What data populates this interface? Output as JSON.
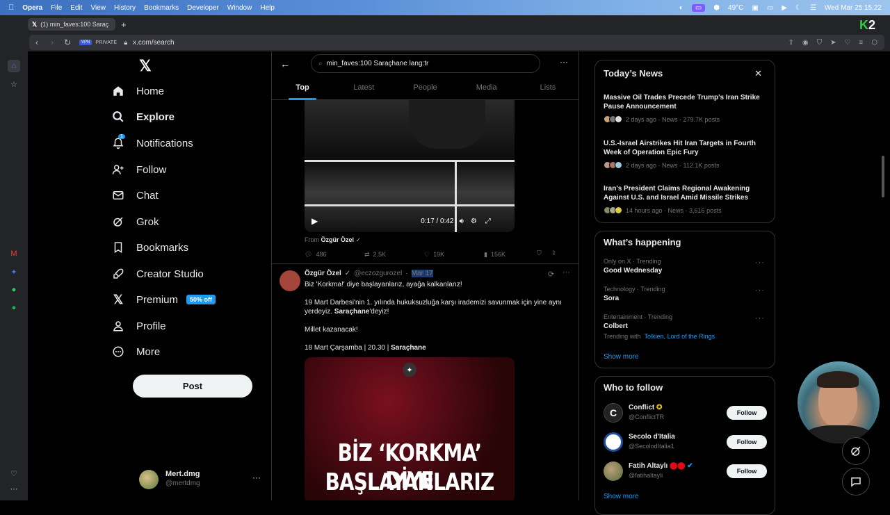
{
  "menubar": {
    "app": "Opera",
    "items": [
      "File",
      "Edit",
      "View",
      "History",
      "Bookmarks",
      "Developer",
      "Window",
      "Help"
    ],
    "temp": "49°C",
    "datetime": "Wed Mar 25  15:22"
  },
  "browser": {
    "tab_title": "(1) min_faves:100 Saraç",
    "vpn": "VPN",
    "private": "PRIVATE",
    "url": "x.com/search"
  },
  "nav": {
    "items": [
      {
        "label": "Home",
        "icon": "home-icon"
      },
      {
        "label": "Explore",
        "icon": "search-icon"
      },
      {
        "label": "Notifications",
        "icon": "bell-icon",
        "badge": "1"
      },
      {
        "label": "Follow",
        "icon": "person-add-icon"
      },
      {
        "label": "Chat",
        "icon": "mail-icon"
      },
      {
        "label": "Grok",
        "icon": "grok-icon"
      },
      {
        "label": "Bookmarks",
        "icon": "bookmark-icon"
      },
      {
        "label": "Creator Studio",
        "icon": "rocket-icon"
      },
      {
        "label": "Premium",
        "icon": "x-logo-icon"
      },
      {
        "label": "Profile",
        "icon": "person-icon"
      },
      {
        "label": "More",
        "icon": "more-circle-icon"
      }
    ],
    "premium_badge": "50% off",
    "post_button": "Post",
    "account": {
      "name": "Mert.dmg",
      "handle": "@mertdmg"
    }
  },
  "search": {
    "query": "min_faves:100 Saraçhane  lang:tr",
    "tabs": [
      "Top",
      "Latest",
      "People",
      "Media",
      "Lists"
    ],
    "active_tab": "Top"
  },
  "tweet1": {
    "video_time": "0:17 / 0:42",
    "from_label": "From",
    "from_name": "Özgür Özel",
    "replies": "486",
    "reposts": "2.5K",
    "likes": "19K",
    "views": "156K"
  },
  "tweet2": {
    "name": "Özgür Özel",
    "handle": "@eczozgurozel",
    "sep": "·",
    "date": "Mar 17",
    "line1": "Biz 'Korkma!' diye başlayanlarız, ayağa kalkanlarız!",
    "para2a": "19 Mart Darbesi'nin 1. yılında hukuksuzluğa karşı irademizi savunmak için yine aynı yerdeyiz. ",
    "para2b": "Saraçhane",
    "para2c": "'deyiz!",
    "line3": "Millet kazanacak!",
    "line4a": "18 Mart Çarşamba | 20.30 | ",
    "line4b": "Saraçhane",
    "poster_line1": "BİZ ‘KORKMA’ DİYE",
    "poster_line2": "BAŞLAYANLARIZ"
  },
  "news": {
    "title": "Today’s News",
    "items": [
      {
        "headline": "Massive Oil Trades Precede Trump's Iran Strike Pause Announcement",
        "meta": "2 days ago · News · 279.7K posts"
      },
      {
        "headline": "U.S.-Israel Airstrikes Hit Iran Targets in Fourth Week of Operation Epic Fury",
        "meta": "2 days ago · News · 112.1K posts"
      },
      {
        "headline": "Iran's President Claims Regional Awakening Against U.S. and Israel Amid Missile Strikes",
        "meta": "14 hours ago · News · 3,616 posts"
      }
    ]
  },
  "happening": {
    "title": "What’s happening",
    "items": [
      {
        "meta": "Only on X · Trending",
        "name": "Good Wednesday"
      },
      {
        "meta": "Technology · Trending",
        "name": "Sora"
      },
      {
        "meta": "Entertainment · Trending",
        "name": "Colbert",
        "with_label": "Trending with",
        "with_links": "Tolkien, Lord of the Rings"
      }
    ],
    "show_more": "Show more"
  },
  "who_to_follow": {
    "title": "Who to follow",
    "items": [
      {
        "name": "Conflict",
        "handle": "@ConflictTR",
        "button": "Follow"
      },
      {
        "name": "Secolo d'Italia",
        "handle": "@SecolodItalia1",
        "button": "Follow"
      },
      {
        "name": "Fatih Altaylı",
        "handle": "@fatihaltayli",
        "button": "Follow"
      }
    ],
    "show_more": "Show more"
  }
}
